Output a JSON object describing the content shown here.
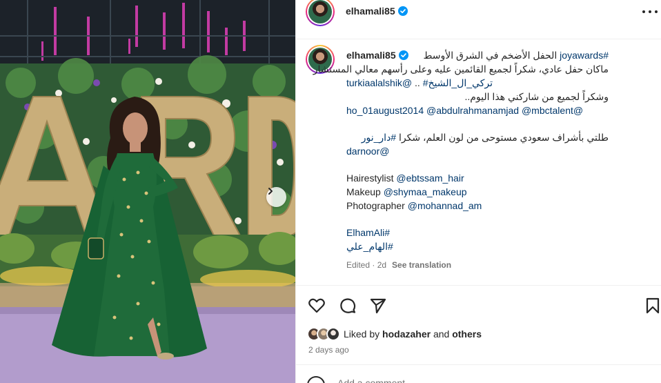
{
  "post": {
    "username": "elhamali85",
    "more_icon": "more-horizontal-icon",
    "verified_icon": "verified-badge-icon",
    "caption_lines": [
      {
        "parts": [
          {
            "t": "#joyawards",
            "link": true
          },
          {
            "t": " الحفل الأضخم في الشرق الأوسط",
            "link": false
          }
        ]
      },
      {
        "parts": [
          {
            "t": "ماكان حفل عادي، شكراً لجميع القائمين عليه وعلى رأسهم معالي المستشار",
            "link": false
          }
        ]
      },
      {
        "parts": [
          {
            "t": "turkiaalalshik@",
            "link": true
          },
          {
            "t": " .. ",
            "link": false
          },
          {
            "t": "#تركي_ال_الشيخ",
            "link": true
          }
        ]
      },
      {
        "parts": [
          {
            "t": "وشكراً لجميع من شاركني هذا اليوم..",
            "link": false
          }
        ]
      },
      {
        "parts": [
          {
            "t": "ho_01august2014 @abdulrahmanamjad @mbctalent@",
            "link": true
          }
        ]
      }
    ],
    "line_dress": [
      {
        "t": "طلتي بأشراف سعودي مستوحى من لون العلم، شكرا ",
        "link": false
      },
      {
        "t": "#دار_نور",
        "link": true
      }
    ],
    "line_darnoor": "darnoor@",
    "credits": [
      {
        "label": "Hairestylist ",
        "handle": "@ebtssam_hair"
      },
      {
        "label": "Makeup ",
        "handle": "@shymaa_makeup"
      },
      {
        "label": "Photographer ",
        "handle": "@mohannad_am"
      }
    ],
    "hashtags": [
      "ElhamAli#",
      "#الهام_علي"
    ],
    "edited": "Edited · 2d",
    "see_translation": "See translation",
    "liked_by_prefix": "Liked by ",
    "liked_by_user": "hodazaher",
    "liked_by_and": " and ",
    "liked_by_others": "others",
    "date": "2 days ago",
    "comment_placeholder": "Add a comment..."
  },
  "colors": {
    "link": "#00376b",
    "muted": "#737373",
    "verified": "#0095f6",
    "dress": "#1f6b3a"
  }
}
